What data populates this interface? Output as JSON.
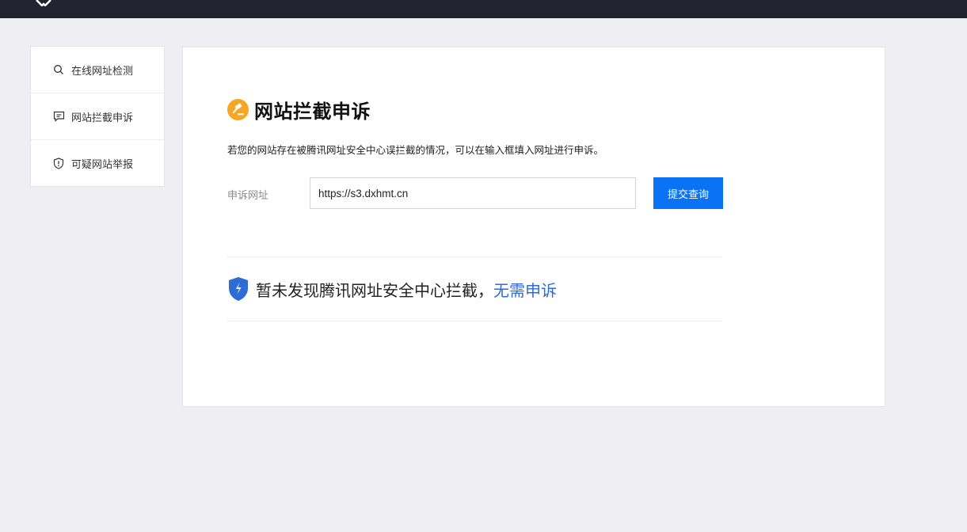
{
  "sidebar": {
    "items": [
      {
        "label": "在线网址检测",
        "icon": "search-icon"
      },
      {
        "label": "网站拦截申诉",
        "icon": "chat-icon"
      },
      {
        "label": "可疑网站举报",
        "icon": "shield-alert-icon"
      }
    ]
  },
  "main": {
    "title": "网站拦截申诉",
    "title_icon": "gavel-badge-icon",
    "description": "若您的网站存在被腾讯网址安全中心误拦截的情况，可以在输入框填入网址进行申诉。",
    "form": {
      "label": "申诉网址",
      "url_value": "https://s3.dxhmt.cn",
      "submit_label": "提交查询"
    },
    "result": {
      "text": "暂未发现腾讯网址安全中心拦截，",
      "link_text": "无需申诉",
      "icon": "shield-check-icon"
    }
  },
  "colors": {
    "topbar": "#22232f",
    "primary_button": "#0a72f5",
    "link": "#2e6bd6",
    "title_badge": "#f5a623",
    "shield": "#2e6bd6",
    "background": "#efeff3"
  }
}
